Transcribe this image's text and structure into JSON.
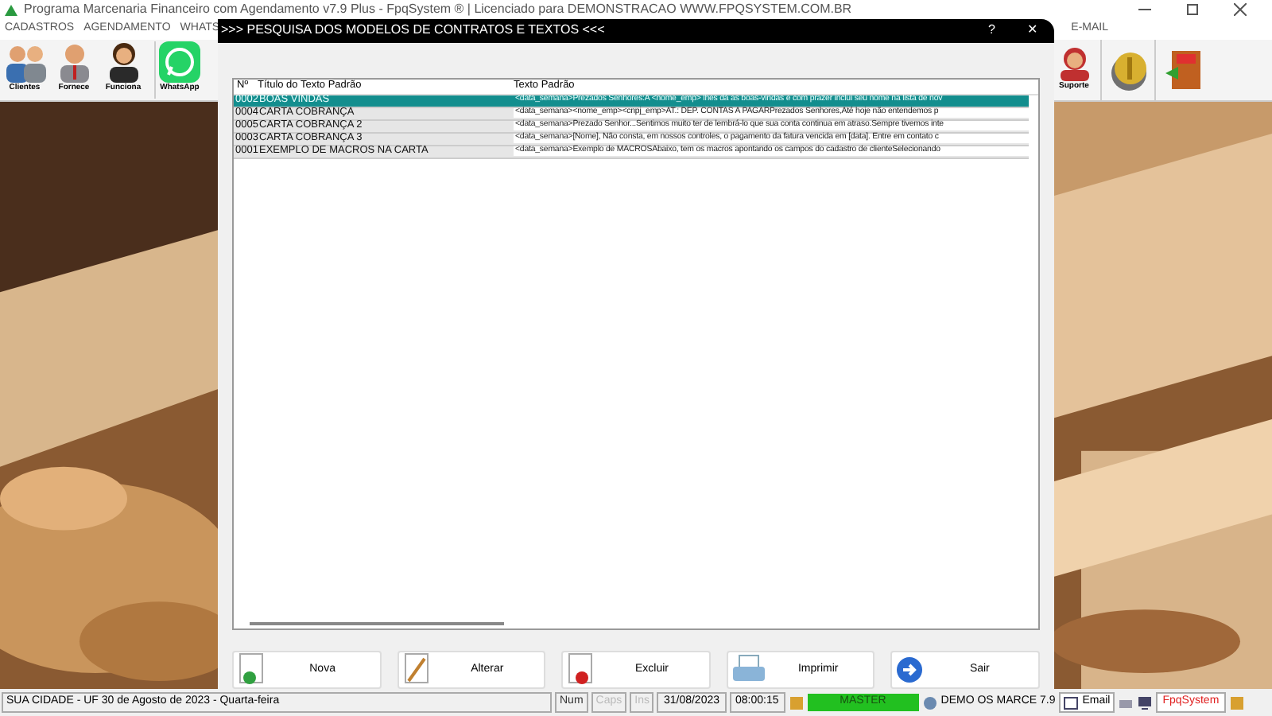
{
  "window": {
    "title": "Programa Marcenaria Financeiro com Agendamento v7.9 Plus - FpqSystem ® | Licenciado para  DEMONSTRACAO WWW.FPQSYSTEM.COM.BR"
  },
  "menu": [
    "CADASTROS",
    "AGENDAMENTO",
    "WHATS",
    "E-MAIL"
  ],
  "toolbar_left": [
    {
      "label": "Clientes",
      "kind": "people"
    },
    {
      "label": "Fornece",
      "kind": "man"
    },
    {
      "label": "Funciona",
      "kind": "woman"
    },
    {
      "label": "WhatsApp",
      "kind": "whatsapp"
    }
  ],
  "toolbar_right": [
    {
      "label": "Suporte",
      "kind": "support"
    },
    {
      "kind": "coin"
    },
    {
      "kind": "exit"
    }
  ],
  "dialog": {
    "title": ">>>  PESQUISA DOS MODELOS DE CONTRATOS E TEXTOS <<<",
    "help": "?",
    "close": "✕",
    "table": {
      "columns": [
        "Nº",
        "Título do Texto Padrão",
        "Texto Padrão"
      ],
      "rows": [
        {
          "cells": [
            "0002",
            "BOAS VINDAS",
            "<data_semana>Prezados Senhores:A <nome_emp> lhes dá as boas-vindas e com prazer inclui seu nome na lista de nov"
          ],
          "selected": true
        },
        {
          "cells": [
            "0004",
            "CARTA COBRANÇA",
            "<data_semana><nome_emp><cnpj_emp>AT.: DEP. CONTAS A PAGARPrezados Senhores,Até hoje não entendemos p"
          ],
          "selected": false
        },
        {
          "cells": [
            "0005",
            "CARTA COBRANÇA 2",
            "<data_semana>Prezado Senhor...Sentimos muito ter de lembrá-lo que sua conta continua em atraso.Sempre tivemos inte"
          ],
          "selected": false
        },
        {
          "cells": [
            "0003",
            "CARTA COBRANÇA 3",
            "<data_semana>[Nome], Não consta, em nossos controles, o pagamento da fatura vencida em [data]. Entre em contato c"
          ],
          "selected": false
        },
        {
          "cells": [
            "0001",
            "EXEMPLO DE MACROS NA CARTA",
            "<data_semana>Exemplo de MACROSAbaixo, tem os macros apontando os campos do cadastro de clienteSelecionando"
          ],
          "selected": false
        }
      ]
    },
    "buttons": [
      {
        "label": "Nova",
        "kind": "new"
      },
      {
        "label": "Alterar",
        "kind": "edit"
      },
      {
        "label": "Excluir",
        "kind": "delete"
      },
      {
        "label": "Imprimir",
        "kind": "print"
      },
      {
        "label": "Sair",
        "kind": "exit"
      }
    ]
  },
  "status_bar": {
    "location": "SUA CIDADE - UF 30 de Agosto de 2023 - Quarta-feira",
    "keys": [
      {
        "label": "Num",
        "disabled": false
      },
      {
        "label": "Caps",
        "disabled": true
      },
      {
        "label": "Ins",
        "disabled": true
      }
    ],
    "date": "31/08/2023",
    "time": "08:00:15",
    "user": "MASTER",
    "company": "DEMO OS MARCE 7.9",
    "email": "Email",
    "brand": "FpqSystem"
  }
}
